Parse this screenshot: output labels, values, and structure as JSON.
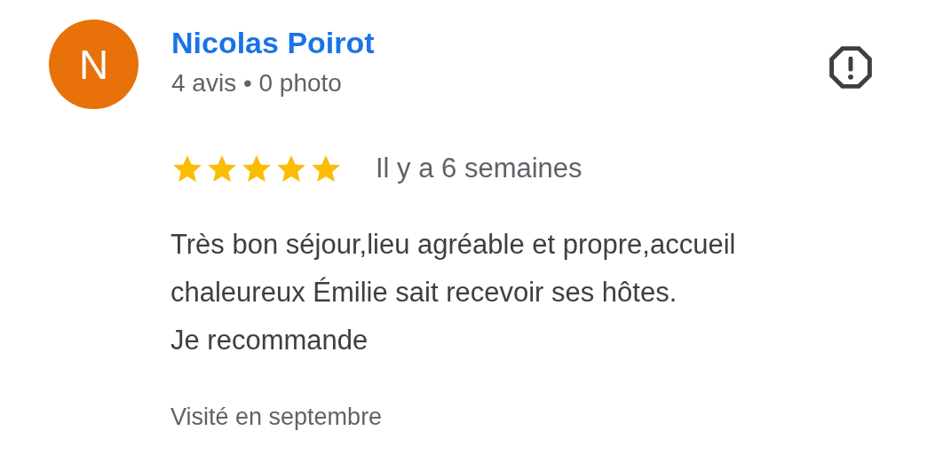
{
  "review": {
    "avatar_letter": "N",
    "author": "Nicolas Poirot",
    "author_meta": "4 avis • 0 photo",
    "stars": 5,
    "time": "Il y a 6 semaines",
    "text": "Très bon séjour,lieu agréable et propre,accueil\nchaleureux Émilie sait recevoir ses hôtes.\nJe recommande",
    "visit": "Visité en septembre"
  }
}
